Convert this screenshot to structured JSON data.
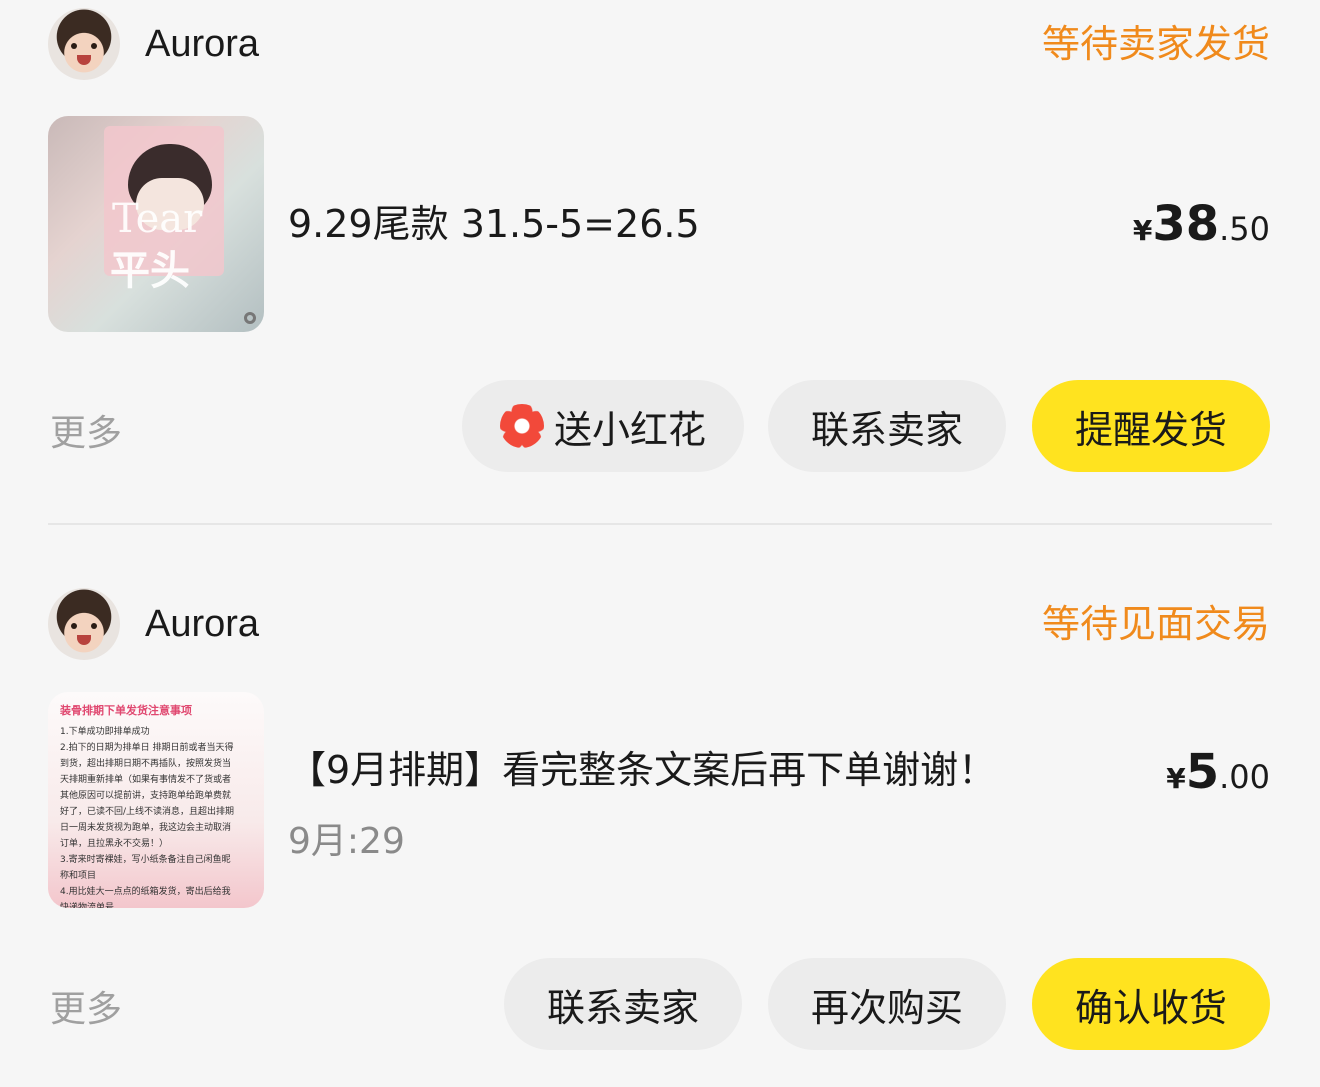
{
  "colors": {
    "accent_status": "#f08a1c",
    "primary_button": "#ffe31f",
    "secondary_button": "#ececec",
    "flower_icon": "#f2493a"
  },
  "orders": [
    {
      "seller": "Aurora",
      "status": "等待卖家发货",
      "thumbnail_text": [
        "Tear",
        "平头"
      ],
      "title": "9.29尾款 31.5-5=26.5",
      "price": {
        "currency": "¥",
        "integer": "38",
        "decimal": ".50"
      },
      "more": "更多",
      "buttons": {
        "flower": "送小红花",
        "contact": "联系卖家",
        "remind": "提醒发货"
      }
    },
    {
      "seller": "Aurora",
      "status": "等待见面交易",
      "thumbnail_text": {
        "heading": "装骨排期下单发货注意事项",
        "lines": [
          "1.下单成功即排单成功",
          "2.拍下的日期为排单日 排期日前或者当天得",
          "到货，超出排期日期不再插队，按照发货当",
          "天排期重新排单（如果有事情发不了货或者",
          "其他原因可以提前讲，支持跑单给跑单费就",
          "好了，已读不回/上线不读消息，且超出排期",
          "日一周未发货视为跑单，我这边会主动取消",
          "订单，且拉黑永不交易！）",
          "3.寄来时寄裸娃，写小纸条备注自己闲鱼昵",
          "称和项目",
          "4.用比娃大一点点的纸箱发货，寄出后给我",
          "快递物流单号"
        ]
      },
      "title": "【9月排期】看完整条文案后再下单谢谢！",
      "subtitle": "9月:29",
      "price": {
        "currency": "¥",
        "integer": "5",
        "decimal": ".00"
      },
      "more": "更多",
      "buttons": {
        "contact": "联系卖家",
        "rebuy": "再次购买",
        "confirm": "确认收货"
      }
    }
  ]
}
